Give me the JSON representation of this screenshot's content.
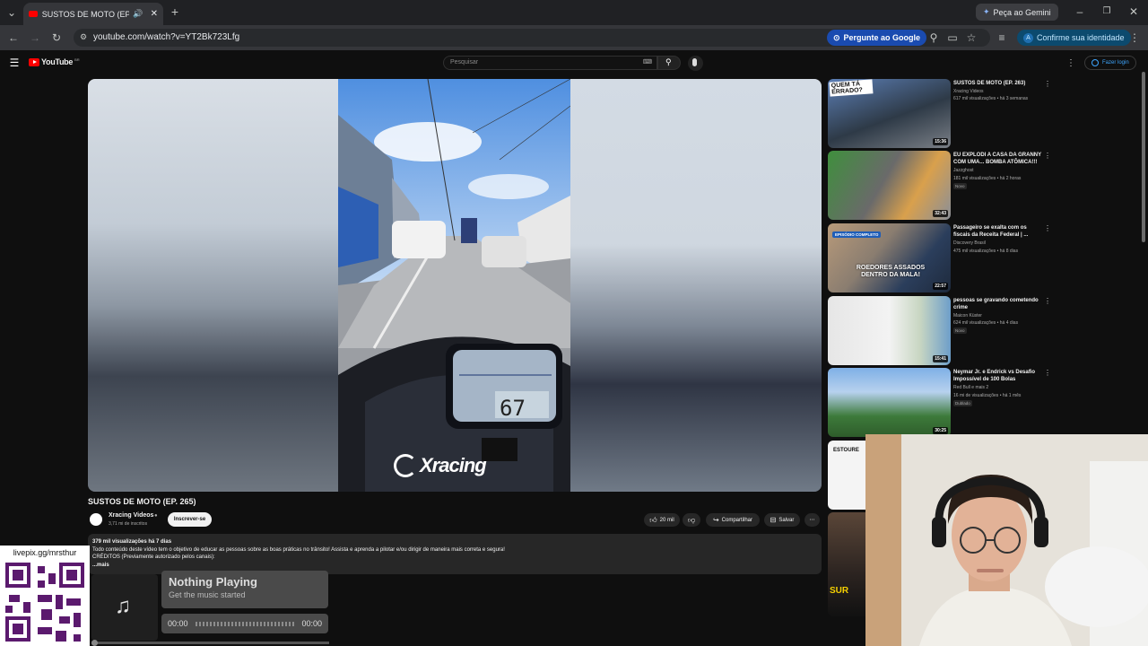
{
  "browser": {
    "tab_title": "SUSTOS DE MOTO (EP. 265)",
    "url": "youtube.com/watch?v=YT2Bk723Lfg",
    "gemini_btn": "Peça ao Gemini",
    "ask_google": "Pergunte ao Google",
    "identity": "Confirme sua identidade",
    "identity_avatar": "A"
  },
  "youtube": {
    "logo": "YouTube",
    "logo_region": "BR",
    "search_placeholder": "Pesquisar",
    "login": "Fazer login"
  },
  "video": {
    "title": "SUSTOS DE MOTO (EP. 265)",
    "watermark": "Xracing",
    "speedo": "67",
    "channel": "Xracing Videos",
    "subscribers": "3,71 mi de inscritos",
    "subscribe": "Inscrever-se",
    "likes": "20 mil",
    "share": "Compartilhar",
    "save": "Salvar",
    "views_line": "379 mil visualizações  há 7 dias",
    "desc1": "Todo conteúdo deste vídeo tem o objetivo de educar as pessoas sobre as boas práticas no trânsito! Assista e aprenda a pilotar e/ou dirigir de maneira mais correta e segura!",
    "desc2": "CRÉDITOS (Previamente autorizado pelos canais):",
    "more": "...mais"
  },
  "sidebar": [
    {
      "title": "SUSTOS DE MOTO (EP. 263)",
      "channel": "Xracing Videos",
      "meta": "617 mil visualizações • há 3 semanas",
      "badge": "",
      "duration": "15:36",
      "overlay": "QUEM TÁ ERRADO?"
    },
    {
      "title": "EU EXPLODI A CASA DA GRANNY COM UMA... BOMBA ATÔMICA!!!",
      "channel": "Jazzghost",
      "meta": "181 mil visualizações • há 2 horas",
      "badge": "Novo",
      "duration": "32:43",
      "overlay": ""
    },
    {
      "title": "Passageiro se exalta com os fiscais da Receita Federal | ...",
      "channel": "Discovery Brasil",
      "meta": "475 mil visualizações • há 8 dias",
      "badge": "",
      "duration": "22:57",
      "overlay": "ROEDORES ASSADOS DENTRO DA MALA!",
      "tag": "EPISÓDIO COMPLETO"
    },
    {
      "title": "pessoas se gravando cometendo crime",
      "channel": "Maicon Küster",
      "meta": "624 mil visualizações • há 4 dias",
      "badge": "Novo",
      "duration": "15:41",
      "overlay": ""
    },
    {
      "title": "Neymar Jr. e Endrick vs Desafio Impossível de 100 Bolas",
      "channel": "Red Bull  e mais 2",
      "meta": "16 mi de visualizações • há 1 mês",
      "badge": "Dublado",
      "duration": "30:25",
      "overlay": ""
    }
  ],
  "sidebar_partial": {
    "sixth_overlay": "ESTOURE",
    "seventh_overlay": "SUR"
  },
  "overlays": {
    "livepix": "livepix.gg/mrsthur",
    "music_title": "Nothing Playing",
    "music_sub": "Get the music started",
    "time_start": "00:00",
    "time_end": "00:00"
  },
  "colors": {
    "accent": "#3ea6ff",
    "yt_red": "#ff0000",
    "bg": "#0f0f0f"
  }
}
